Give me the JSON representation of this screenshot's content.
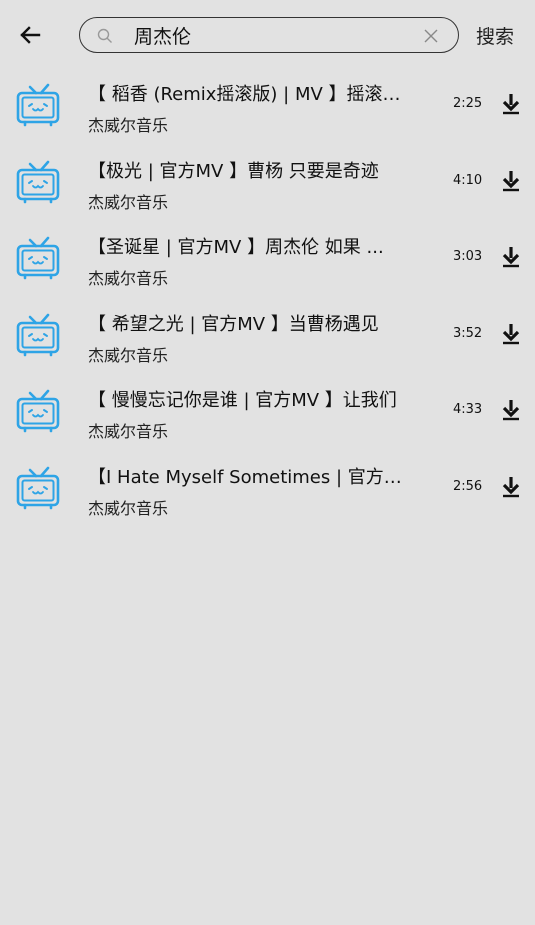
{
  "header": {
    "back_icon": "arrow-left-icon",
    "search": {
      "value": "周杰伦",
      "icon": "search-icon",
      "clear_icon": "close-icon"
    },
    "search_button_label": "搜索"
  },
  "results": [
    {
      "title": "【 稻香 (Remix摇滚版) | MV 】摇滚版 周杰伦 稻香",
      "artist": "杰威尔音乐",
      "duration": "2:25"
    },
    {
      "title": "【极光 | 官方MV 】曹杨 只要是奇迹",
      "artist": "杰威尔音乐",
      "duration": "4:10"
    },
    {
      "title": "【圣诞星 | 官方MV 】周杰伦 如果 ...",
      "artist": "杰威尔音乐",
      "duration": "3:03"
    },
    {
      "title": "【 希望之光 | 官方MV 】当曹杨遇见",
      "artist": "杰威尔音乐",
      "duration": "3:52"
    },
    {
      "title": "【 慢慢忘记你是谁 | 官方MV 】让我们",
      "artist": "杰威尔音乐",
      "duration": "4:33"
    },
    {
      "title": "【I Hate Myself Sometimes | 官方MV",
      "artist": "杰威尔音乐",
      "duration": "2:56"
    }
  ],
  "row_icons": {
    "thumbnail": "tv-icon",
    "download": "download-icon"
  },
  "colors": {
    "background": "#e2e2e2",
    "tv_icon": "#2ea4e6",
    "text": "#111111"
  }
}
